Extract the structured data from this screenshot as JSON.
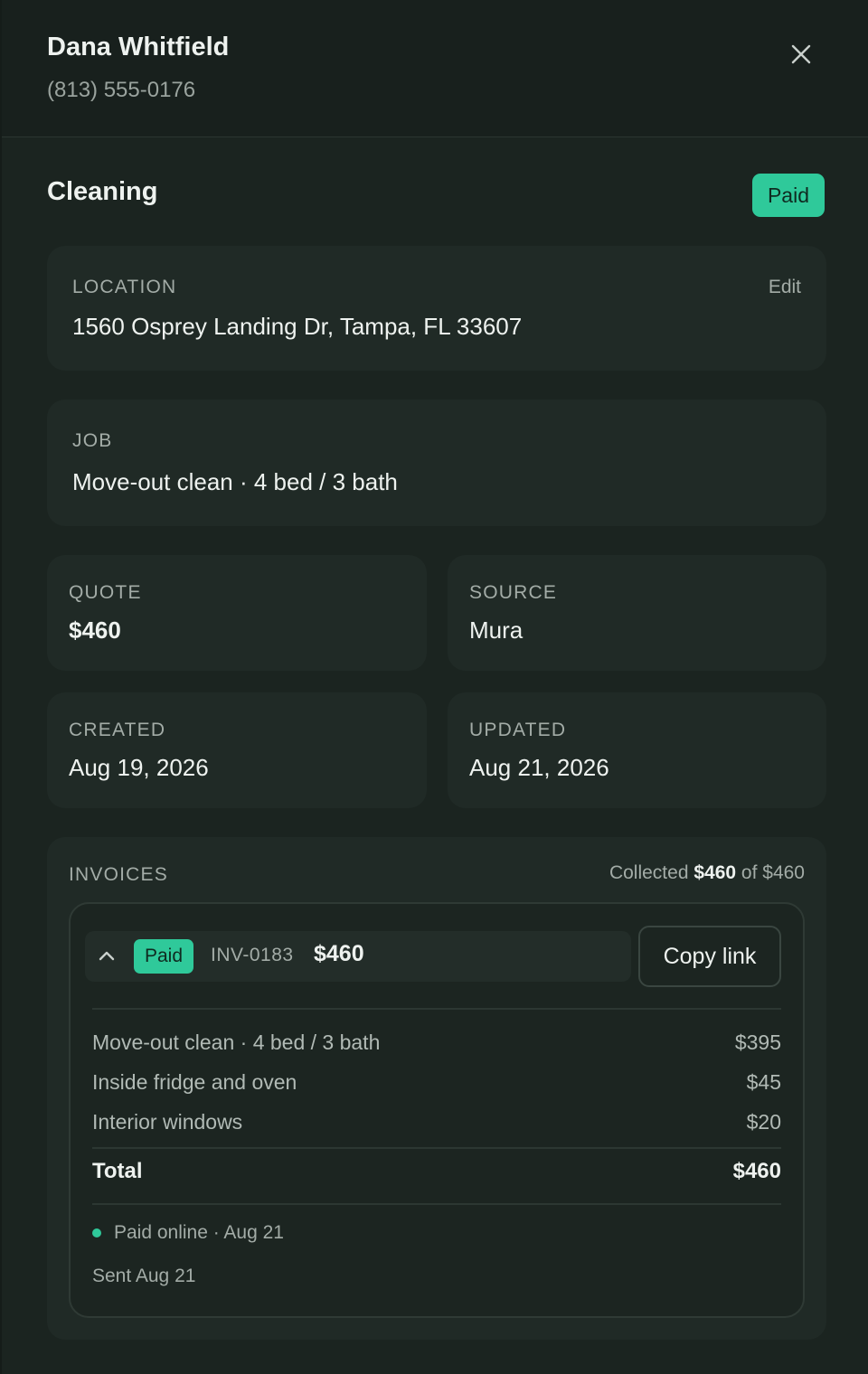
{
  "contact": {
    "name": "Dana Whitfield",
    "phone": "(813) 555-0176"
  },
  "job_header": {
    "title": "Cleaning",
    "status": "Paid",
    "status_color": "#2fc99a"
  },
  "location": {
    "label": "LOCATION",
    "edit_label": "Edit",
    "address": "1560 Osprey Landing Dr, Tampa, FL 33607"
  },
  "job": {
    "label": "JOB",
    "description": "Move-out clean · 4 bed / 3 bath"
  },
  "quote": {
    "label": "QUOTE",
    "value": "$460"
  },
  "source": {
    "label": "SOURCE",
    "value": "Mura"
  },
  "created": {
    "label": "CREATED",
    "value": "Aug 19, 2026"
  },
  "updated": {
    "label": "UPDATED",
    "value": "Aug 21, 2026"
  },
  "invoices": {
    "label": "INVOICES",
    "collected_prefix": "Collected",
    "collected_amount": "$460",
    "collected_of": "of $460",
    "items": [
      {
        "status": "Paid",
        "number": "INV-0183",
        "amount": "$460",
        "copy_link_label": "Copy link",
        "line_items": [
          {
            "description": "Move-out clean · 4 bed / 3 bath",
            "amount": "$395"
          },
          {
            "description": "Inside fridge and oven",
            "amount": "$45"
          },
          {
            "description": "Interior windows",
            "amount": "$20"
          }
        ],
        "total_label": "Total",
        "total_amount": "$460",
        "payment_status": "Paid online · Aug 21",
        "sent": "Sent Aug 21"
      }
    ]
  },
  "icons": {
    "close": "close-icon",
    "chevron": "chevron-up-icon"
  }
}
